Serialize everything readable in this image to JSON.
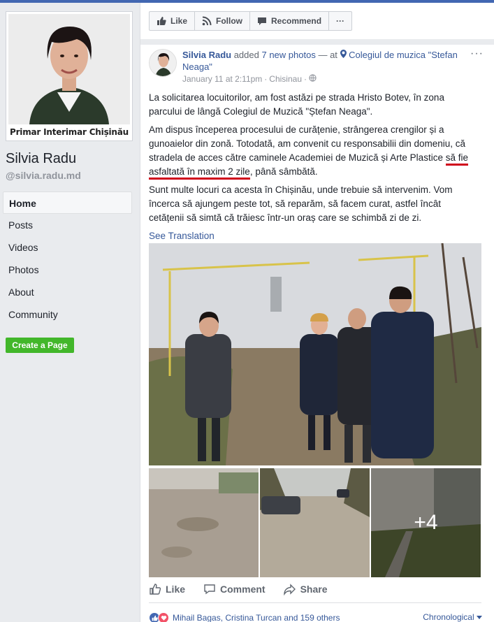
{
  "profile": {
    "caption": "Primar Interimar Chișinău",
    "name": "Silvia Radu",
    "handle": "@silvia.radu.md"
  },
  "nav": {
    "items": [
      {
        "label": "Home",
        "active": true
      },
      {
        "label": "Posts"
      },
      {
        "label": "Videos"
      },
      {
        "label": "Photos"
      },
      {
        "label": "About"
      },
      {
        "label": "Community"
      }
    ],
    "create_page": "Create a Page"
  },
  "page_actions": {
    "like": "Like",
    "follow": "Follow",
    "recommend": "Recommend",
    "more": "···"
  },
  "post": {
    "author": "Silvia Radu",
    "added": "added",
    "photos_link": "7 new photos",
    "at": "— at",
    "place": "Colegiul de muzica \"Stefan Neaga\"",
    "date": "January 11 at 2:11pm",
    "location": "Chisinau",
    "dot": "·",
    "more": "···",
    "paragraph1": "La solicitarea locuitorilor, am fost astăzi pe strada Hristo Botev, în zona parcului de lângă Colegiul de Muzică \"Ștefan Neaga\".",
    "paragraph2_start": "Am dispus începerea procesului de curățenie, strângerea crengilor și a gunoaielor din zonă. Totodată, am convenit cu responsabilii din domeniu, că stradela de acces către caminele Academiei de Muzică și Arte Plastice ",
    "paragraph2_highlight": "să fie asfaltată în maxim 2 zile",
    "paragraph2_end": ", până sâmbătă.",
    "paragraph3": "Sunt multe locuri ca acesta în Chișinău, unde trebuie să intervenim. Vom încerca să ajungem peste tot, să reparăm, să facem curat, astfel încât cetățenii să simtă că trăiesc într-un oraș care se schimbă zi de zi.",
    "see_translation": "See Translation",
    "more_photos": "+4",
    "like": "Like",
    "comment": "Comment",
    "share": "Share",
    "reactions_text": "Mihail Bagas, Cristina Turcan and 159 others",
    "sort": "Chronological"
  },
  "colors": {
    "link": "#365899",
    "brand": "#4267b2",
    "green": "#42b72a",
    "underline": "#d0021b"
  }
}
